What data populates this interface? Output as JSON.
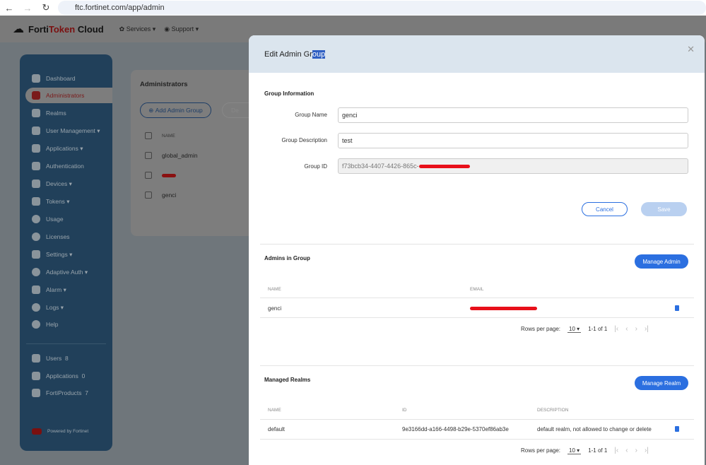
{
  "browser": {
    "url": "ftc.fortinet.com/app/admin"
  },
  "header": {
    "logo_a": "Forti",
    "logo_b": "Token",
    "logo_c": " Cloud",
    "services": "Services",
    "support": "Support"
  },
  "sidebar": {
    "items": [
      "Dashboard",
      "Administrators",
      "Realms",
      "User Management",
      "Applications",
      "Authentication",
      "Devices",
      "Tokens",
      "Usage",
      "Licenses",
      "Settings",
      "Adaptive Auth",
      "Alarm",
      "Logs",
      "Help"
    ],
    "stats": [
      {
        "label": "Users",
        "count": "8"
      },
      {
        "label": "Applications",
        "count": "0"
      },
      {
        "label": "FortiProducts",
        "count": "7"
      }
    ],
    "powered": "Powered by Fortinet"
  },
  "page": {
    "title": "Administrators",
    "add_button": "Add Admin Group",
    "delete_button": "De",
    "col_name": "NAME",
    "rows": [
      "global_admin",
      "",
      "genci"
    ]
  },
  "modal": {
    "title_a": "Edit Admin Gr",
    "title_b": "oup",
    "group_info": "Group Information",
    "group_name_label": "Group Name",
    "group_name": "genci",
    "group_desc_label": "Group Description",
    "group_desc": "test",
    "group_id_label": "Group ID",
    "group_id": "f73bcb34-4407-4426-865c-",
    "cancel": "Cancel",
    "save": "Save",
    "admins_title": "Admins in Group",
    "manage_admin": "Manage Admin",
    "admins_cols": [
      "NAME",
      "EMAIL"
    ],
    "admins_rows": [
      {
        "name": "genci"
      }
    ],
    "realms_title": "Managed Realms",
    "manage_realm": "Manage Realm",
    "realms_cols": [
      "NAME",
      "ID",
      "DESCRIPTION"
    ],
    "realms_rows": [
      {
        "name": "default",
        "id": "9e3166dd-a166-4498-b29e-5370ef86ab3e",
        "description": "default realm, not allowed to change or delete"
      }
    ],
    "rows_per_page": "Rows per page:",
    "rpp_value": "10",
    "range": "1-1 of 1"
  }
}
